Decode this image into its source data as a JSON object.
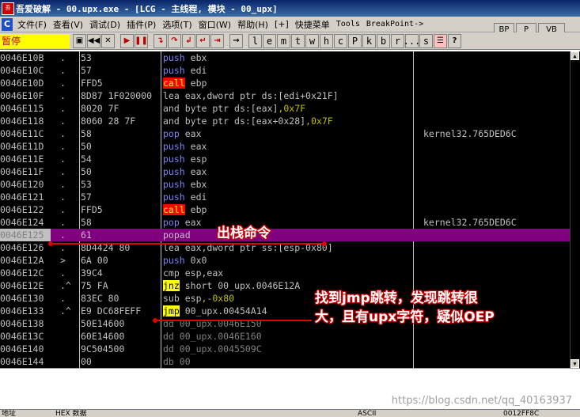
{
  "window": {
    "icon_label": "吾爱\n破解",
    "title": "吾爱破解 - 00.upx.exe - [LCG - 主线程, 模块 - 00_upx]"
  },
  "menu": {
    "items": [
      {
        "label": "文件(F)"
      },
      {
        "label": "查看(V)"
      },
      {
        "label": "调试(D)"
      },
      {
        "label": "插件(P)"
      },
      {
        "label": "选项(T)"
      },
      {
        "label": "窗口(W)"
      },
      {
        "label": "帮助(H)"
      },
      {
        "label": "[+]"
      },
      {
        "label": "快捷菜单"
      },
      {
        "label": "Tools"
      },
      {
        "label": "BreakPoint->"
      }
    ],
    "side_buttons": [
      "BP",
      "P",
      "VB"
    ]
  },
  "toolbar": {
    "status": "暂停",
    "letters": [
      "l",
      "e",
      "m",
      "t",
      "w",
      "h",
      "c",
      "P",
      "k",
      "b",
      "r",
      "...",
      "s"
    ]
  },
  "rows": [
    {
      "addr": "0046E10B",
      "mark": ".",
      "hex": "53",
      "mn": "push",
      "ops": "ebx",
      "comment": ""
    },
    {
      "addr": "0046E10C",
      "mark": ".",
      "hex": "57",
      "mn": "push",
      "ops": "edi",
      "comment": ""
    },
    {
      "addr": "0046E10D",
      "mark": ".",
      "hex": "FFD5",
      "mn": "call",
      "ops": "ebp",
      "comment": ""
    },
    {
      "addr": "0046E10F",
      "mark": ".",
      "hex": "8D87 1F020000",
      "mn": "lea",
      "ops": "eax,dword ptr ds:[edi+0x21F]",
      "comment": ""
    },
    {
      "addr": "0046E115",
      "mark": ".",
      "hex": "8020 7F",
      "mn": "and",
      "ops": "byte ptr ds:[eax],0x7F",
      "comment": ""
    },
    {
      "addr": "0046E118",
      "mark": ".",
      "hex": "8060 28 7F",
      "mn": "and",
      "ops": "byte ptr ds:[eax+0x28],0x7F",
      "comment": ""
    },
    {
      "addr": "0046E11C",
      "mark": ".",
      "hex": "58",
      "mn": "pop",
      "ops": "eax",
      "comment": "kernel32.765DED6C"
    },
    {
      "addr": "0046E11D",
      "mark": ".",
      "hex": "50",
      "mn": "push",
      "ops": "eax",
      "comment": ""
    },
    {
      "addr": "0046E11E",
      "mark": ".",
      "hex": "54",
      "mn": "push",
      "ops": "esp",
      "comment": ""
    },
    {
      "addr": "0046E11F",
      "mark": ".",
      "hex": "50",
      "mn": "push",
      "ops": "eax",
      "comment": ""
    },
    {
      "addr": "0046E120",
      "mark": ".",
      "hex": "53",
      "mn": "push",
      "ops": "ebx",
      "comment": ""
    },
    {
      "addr": "0046E121",
      "mark": ".",
      "hex": "57",
      "mn": "push",
      "ops": "edi",
      "comment": ""
    },
    {
      "addr": "0046E122",
      "mark": ".",
      "hex": "FFD5",
      "mn": "call",
      "ops": "ebp",
      "comment": ""
    },
    {
      "addr": "0046E124",
      "mark": ".",
      "hex": "58",
      "mn": "pop",
      "ops": "eax",
      "comment": "kernel32.765DED6C"
    },
    {
      "addr": "0046E125",
      "mark": ".",
      "hex": "61",
      "mn": "popad",
      "ops": "",
      "comment": ""
    },
    {
      "addr": "0046E126",
      "mark": ".",
      "hex": "8D4424 80",
      "mn": "lea",
      "ops": "eax,dword ptr ss:[esp-0x80]",
      "comment": ""
    },
    {
      "addr": "0046E12A",
      "mark": ">",
      "hex": "6A 00",
      "mn": "push",
      "ops": "0x0",
      "comment": ""
    },
    {
      "addr": "0046E12C",
      "mark": ".",
      "hex": "39C4",
      "mn": "cmp",
      "ops": "esp,eax",
      "comment": ""
    },
    {
      "addr": "0046E12E",
      "mark": ".^",
      "hex": "75 FA",
      "mn": "jnz",
      "ops": "short 00_upx.0046E12A",
      "comment": ""
    },
    {
      "addr": "0046E130",
      "mark": ".",
      "hex": "83EC 80",
      "mn": "sub",
      "ops": "esp,-0x80",
      "comment": ""
    },
    {
      "addr": "0046E133",
      "mark": ".^",
      "hex": "E9 DC68FEFF",
      "mn": "jmp",
      "ops": "00_upx.00454A14",
      "comment": ""
    },
    {
      "addr": "0046E138",
      "mark": "",
      "hex": "50E14600",
      "mn": "dd",
      "ops": "00_upx.0046E150",
      "comment": ""
    },
    {
      "addr": "0046E13C",
      "mark": "",
      "hex": "60E14600",
      "mn": "dd",
      "ops": "00_upx.0046E160",
      "comment": ""
    },
    {
      "addr": "0046E140",
      "mark": "",
      "hex": "9C504500",
      "mn": "dd",
      "ops": "00_upx.0045509C",
      "comment": ""
    },
    {
      "addr": "0046E144",
      "mark": "",
      "hex": "00",
      "mn": "db",
      "ops": "00",
      "comment": ""
    }
  ],
  "annotations": {
    "popad_note": "出栈命令",
    "jmp_note_1": "找到jmp跳转，发现跳转很",
    "jmp_note_2": "大，且有upx字符，疑似OEP"
  },
  "watermark": "https://blog.csdn.net/qq_40163937",
  "bottom_bar": {
    "left": "地址",
    "mid": "HEX 数据",
    "ascii": "ASCII",
    "right": "0012FF8C"
  }
}
